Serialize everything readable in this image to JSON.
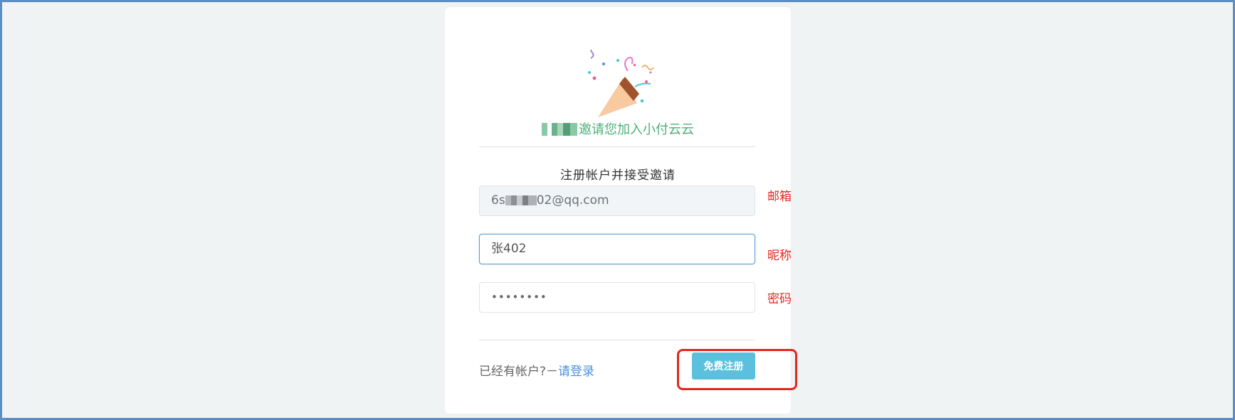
{
  "invite": {
    "message": "邀请您加入小付云云"
  },
  "form": {
    "heading": "注册帐户并接受邀请",
    "email_prefix": "6s",
    "email_suffix": "02@qq.com",
    "nickname_value": "张402",
    "password_value": "••••••••",
    "submit_label": "免费注册"
  },
  "footer": {
    "has_account_text": "已经有帐户?－",
    "login_link": "请登录"
  },
  "annotations": {
    "email_label": "邮箱",
    "nickname_label": "昵称",
    "password_label": "密码"
  },
  "colors": {
    "accent": "#5bc0de",
    "invite_text": "#4caf7a",
    "annotation": "#e0281e",
    "link": "#4a90e2"
  }
}
